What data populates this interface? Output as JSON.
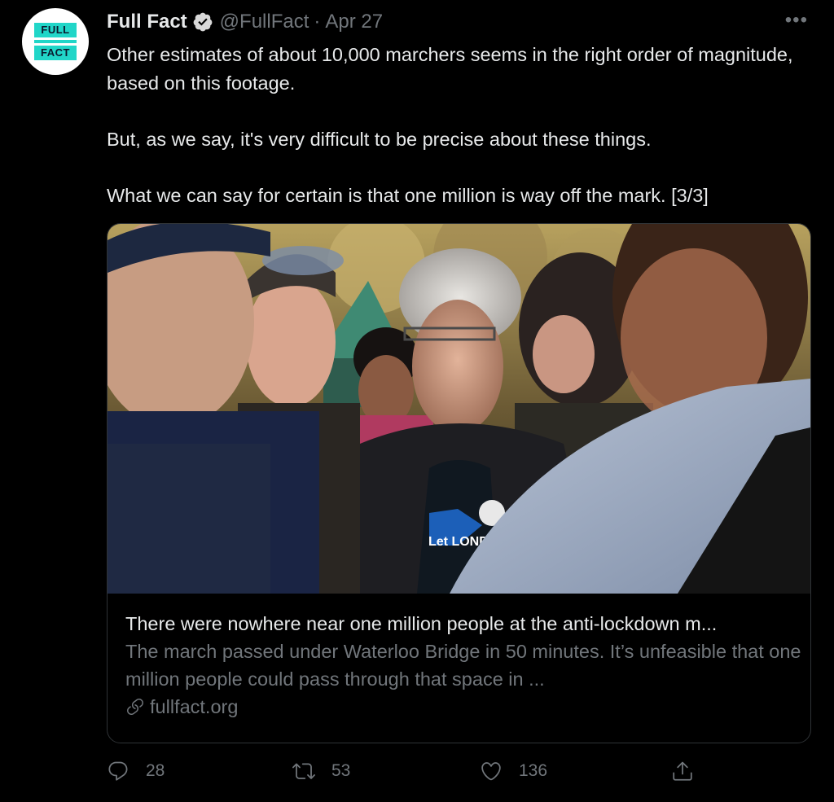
{
  "tweet": {
    "author_name": "Full Fact",
    "handle": "@FullFact",
    "separator": "·",
    "date": "Apr 27",
    "more_label": "•••",
    "logo": {
      "line1": "FULL",
      "line2": "FACT"
    },
    "text": [
      "Other estimates of about 10,000 marchers seems in the right order of magnitude, based on this footage.",
      "But, as we say, it's very difficult to be precise about these things.",
      "What we can say for certain is that one million is way off the mark. [3/3]"
    ]
  },
  "card": {
    "title": "There were nowhere near one million people at the anti-lockdown m...",
    "description": "The march passed under Waterloo Bridge in 50 minutes. It’s unfeasible that one million people could pass through that space in ...",
    "domain": "fullfact.org",
    "photo_badge_text": "Let LONDON Live"
  },
  "actions": {
    "replies": "28",
    "retweets": "53",
    "likes": "136"
  },
  "colors": {
    "background": "#000000",
    "text": "#e7e9ea",
    "muted": "#71767b",
    "verified": "#d9d9d9",
    "logo_accent": "#21d6c8",
    "border": "#2f3336"
  },
  "icons": [
    "verified-badge-icon",
    "more-icon",
    "link-icon",
    "reply-icon",
    "retweet-icon",
    "like-icon",
    "share-icon"
  ]
}
